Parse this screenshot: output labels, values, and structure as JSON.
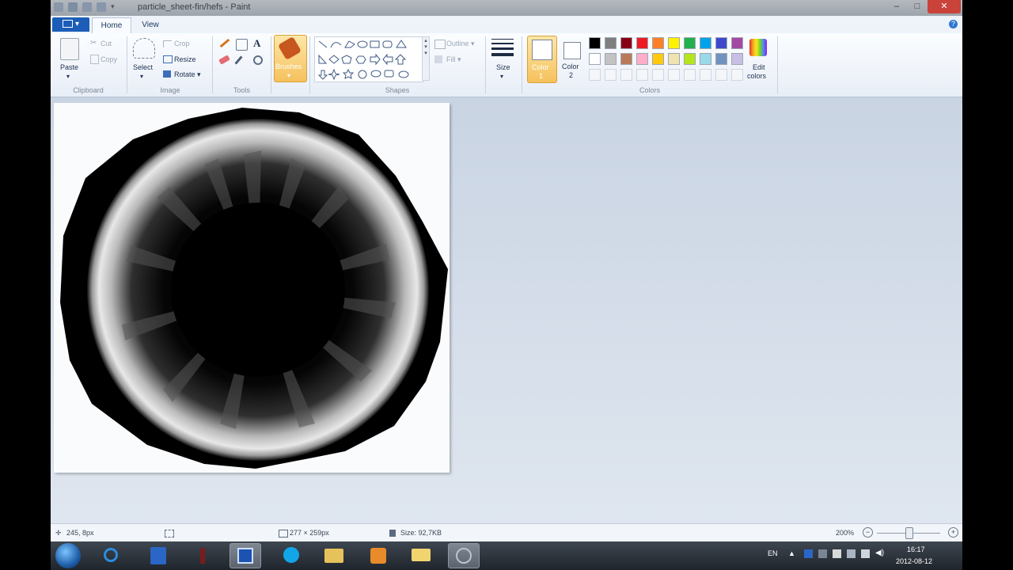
{
  "window": {
    "title": "particle_sheet-fin/hefs - Paint",
    "controls": {
      "minimize": "–",
      "maximize": "□",
      "close": "✕"
    }
  },
  "tabs": {
    "menu_label": "▾",
    "home": "Home",
    "view": "View",
    "help": "?"
  },
  "clipboard": {
    "paste": "Paste",
    "cut": "Cut",
    "copy": "Copy",
    "group": "Clipboard"
  },
  "image": {
    "select": "Select",
    "crop": "Crop",
    "resize": "Resize",
    "rotate": "Rotate ▾",
    "group": "Image"
  },
  "tools": {
    "text_glyph": "A",
    "group": "Tools"
  },
  "brushes": {
    "label": "Brushes"
  },
  "shapes": {
    "outline": "Outline ▾",
    "fill": "Fill ▾",
    "group": "Shapes"
  },
  "size": {
    "label": "Size"
  },
  "colors": {
    "color1_line1": "Color",
    "color1_line2": "1",
    "color2_line1": "Color",
    "color2_line2": "2",
    "edit_line1": "Edit",
    "edit_line2": "colors",
    "group": "Colors",
    "palette_row1": [
      "#000000",
      "#7f7f7f",
      "#880015",
      "#ed1c24",
      "#ff7f27",
      "#fff200",
      "#22b14c",
      "#00a2e8",
      "#3f48cc",
      "#a349a4"
    ],
    "palette_row2": [
      "#ffffff",
      "#c3c3c3",
      "#b97a57",
      "#ffaec9",
      "#ffc90e",
      "#efe4b0",
      "#b5e61d",
      "#99d9ea",
      "#7092be",
      "#c8bfe7"
    ]
  },
  "status": {
    "cursor_pos": "245, 8px",
    "selection_size": "277 × 259px",
    "file_size": "Size: 92,7KB",
    "zoom": "200%",
    "zoom_level": 0.5
  },
  "taskbar": {
    "language": "EN",
    "time": "16:17",
    "date": "2012-08-12"
  }
}
